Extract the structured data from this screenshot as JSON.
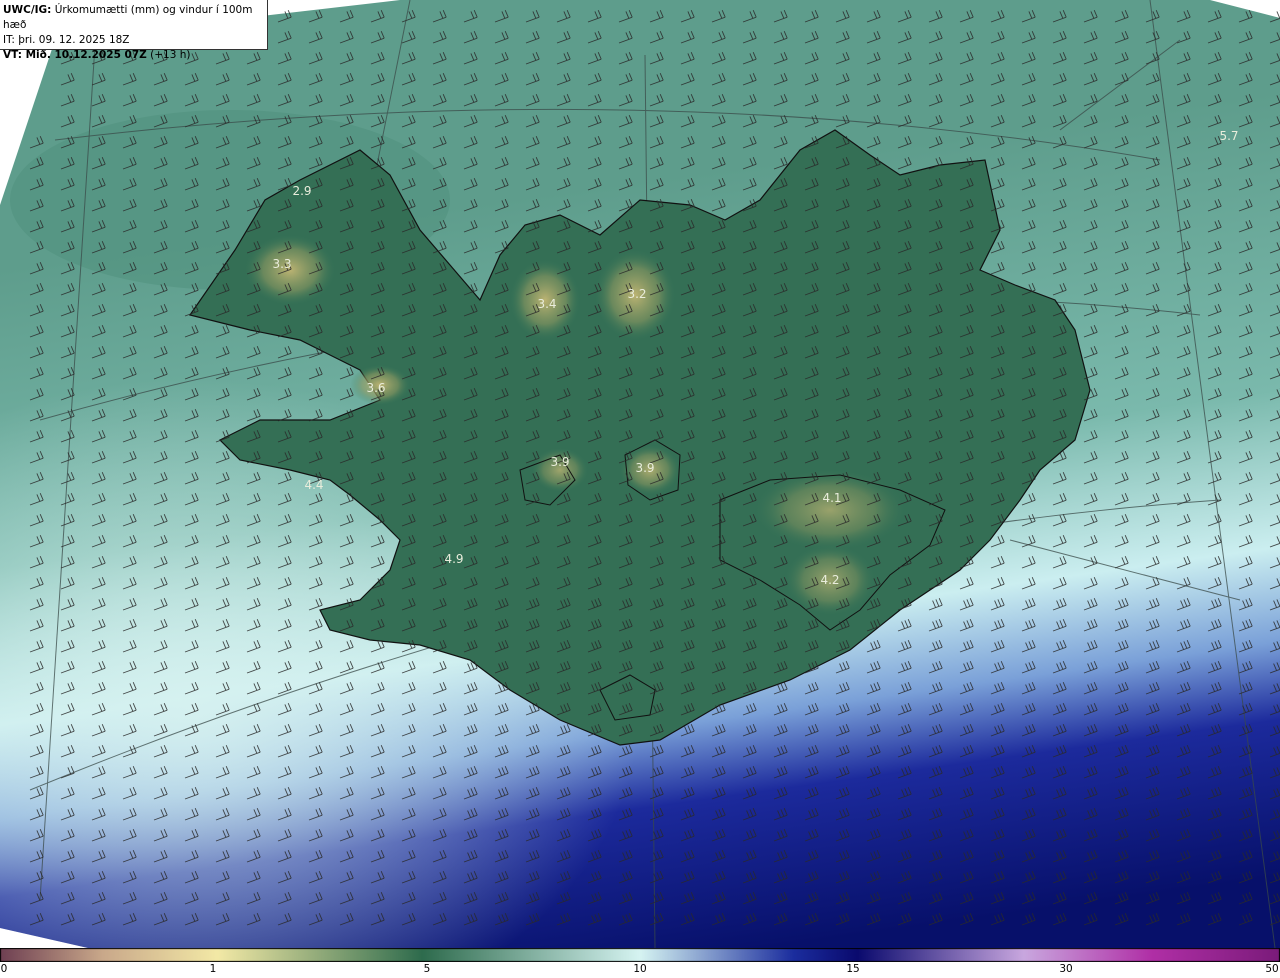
{
  "header": {
    "product": "UWC/IG:",
    "description": "Úrkomumætti (mm) og vindur í 100m hæð",
    "it_line": "IT: þri. 09. 12. 2025 18Z",
    "vt_label": "VT: Mið. 10.12.2025 07Z",
    "vt_lead": "(+13 h)"
  },
  "map": {
    "labels": [
      "2.9",
      "3.3",
      "3.4",
      "3.2",
      "3.6",
      "3.9",
      "3.9",
      "4.1",
      "4.2",
      "4.9",
      "4.4",
      "5.7"
    ],
    "colors": {
      "land_low": "#2f6b4e",
      "land_high": "#b8b06a",
      "sea_mid": "#7fb8a8",
      "sea_light": "#c9ece7",
      "sea_deep": "#0a1a7a",
      "barb": "#2a2a2a",
      "coast": "#111111"
    }
  },
  "colorbar": {
    "ticks": [
      "0",
      "1",
      "5",
      "10",
      "15",
      "30",
      "50"
    ],
    "stops": [
      "#6e3f52",
      "#c9a88a",
      "#f3e9a6",
      "#2e6b4d",
      "#d6f4f2",
      "#1b2d9e",
      "#0a0a6e",
      "#c9a7df",
      "#b02fa6",
      "#7a1b7a"
    ]
  }
}
